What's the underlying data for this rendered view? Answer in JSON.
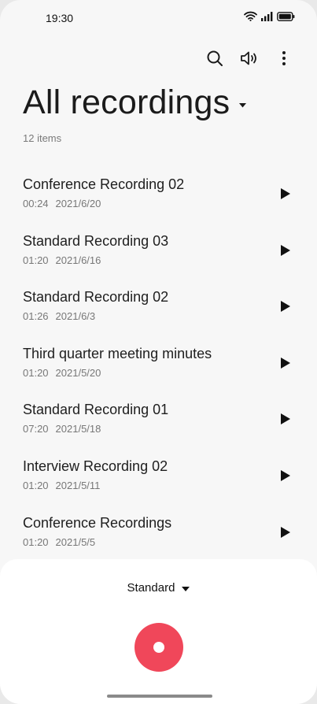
{
  "status_bar": {
    "time": "19:30"
  },
  "icons": {
    "wifi": "wifi-icon",
    "signal": "signal-icon",
    "battery": "battery-icon",
    "search": "search-icon",
    "speaker": "speaker-icon",
    "more": "more-vertical-icon",
    "play": "play-icon",
    "record": "record-icon"
  },
  "header": {
    "title": "All recordings",
    "count": "12 items"
  },
  "recordings": [
    {
      "title": "Conference Recording 02",
      "duration": "00:24",
      "date": "2021/6/20"
    },
    {
      "title": "Standard Recording 03",
      "duration": "01:20",
      "date": "2021/6/16"
    },
    {
      "title": "Standard Recording 02",
      "duration": "01:26",
      "date": "2021/6/3"
    },
    {
      "title": "Third quarter meeting minutes",
      "duration": "01:20",
      "date": "2021/5/20"
    },
    {
      "title": "Standard Recording 01",
      "duration": "07:20",
      "date": "2021/5/18"
    },
    {
      "title": "Interview Recording 02",
      "duration": "01:20",
      "date": "2021/5/11"
    },
    {
      "title": "Conference Recordings",
      "duration": "01:20",
      "date": "2021/5/5"
    }
  ],
  "bottom": {
    "mode": "Standard"
  },
  "colors": {
    "accent": "#f0475a",
    "background": "#f7f7f7",
    "text": "#1e1e1e",
    "muted": "#777777"
  }
}
